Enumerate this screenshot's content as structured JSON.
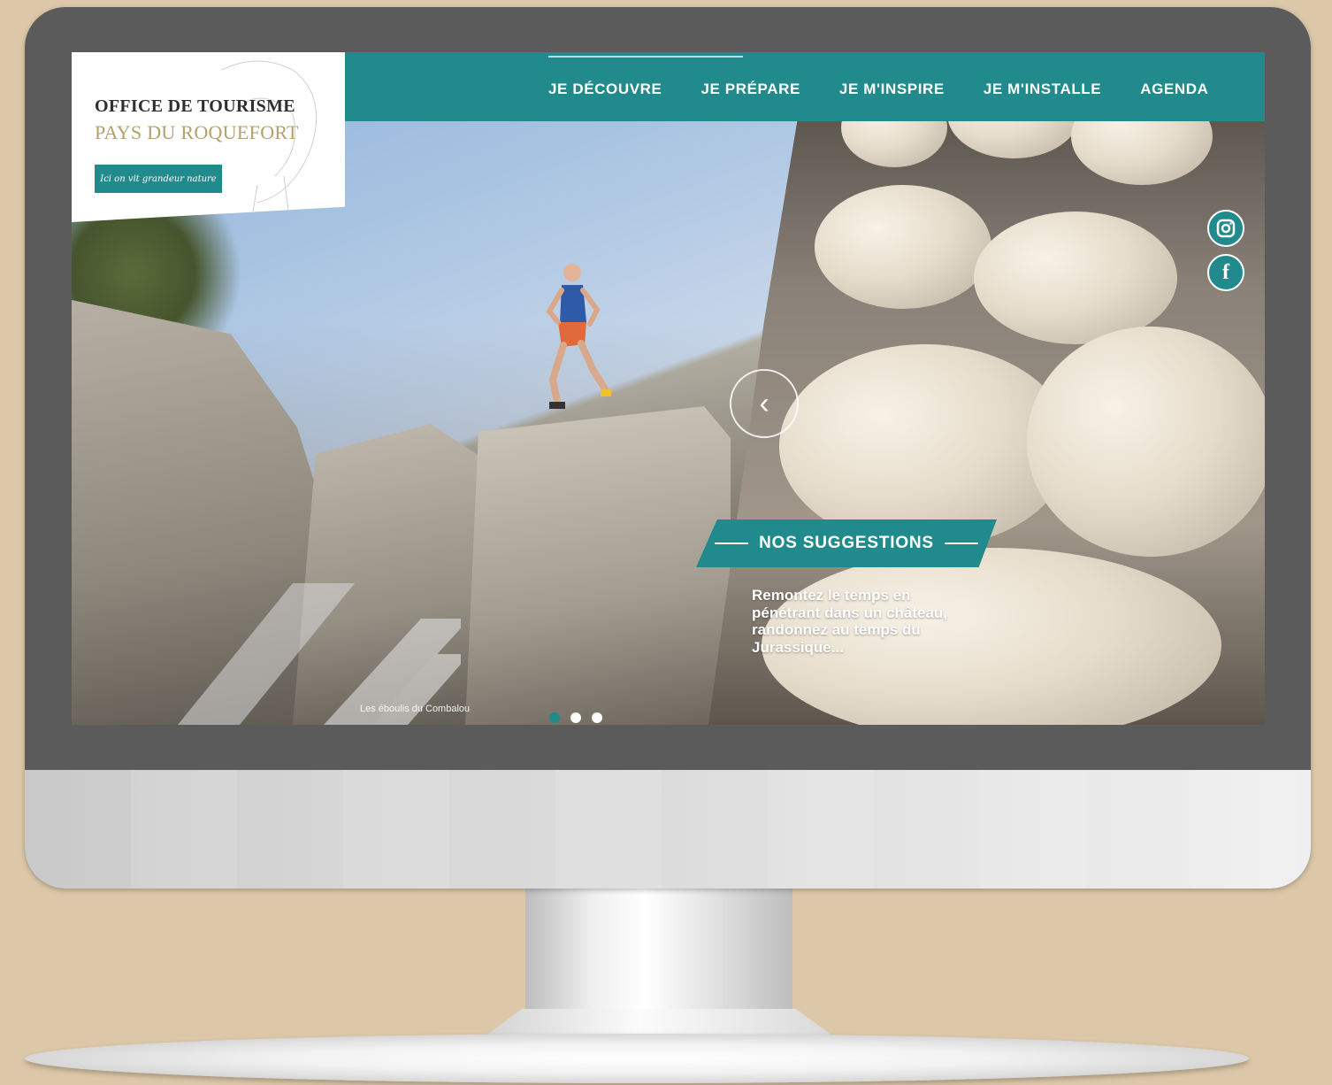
{
  "site": {
    "logo": {
      "line1": "OFFICE DE TOURISME",
      "line2": "PAYS DU ROQUEFORT",
      "tagline": "Ici on vit grandeur nature"
    },
    "nav": [
      {
        "label": "JE DÉCOUVRE"
      },
      {
        "label": "JE PRÉPARE"
      },
      {
        "label": "JE M'INSPIRE"
      },
      {
        "label": "JE M'INSTALLE"
      },
      {
        "label": "AGENDA"
      }
    ],
    "hero": {
      "caption": "Les éboulis du Combalou",
      "dots": {
        "count": 3,
        "active_index": 0
      }
    },
    "suggestions": {
      "title": "NOS SUGGESTIONS",
      "text": "Remontez le temps en pénétrant dans un château, randonnez au temps du Jurassique..."
    },
    "social": [
      {
        "name": "instagram-icon"
      },
      {
        "name": "facebook-icon",
        "glyph": "f"
      }
    ],
    "prev_arrow_glyph": "‹",
    "colors": {
      "accent": "#218a8c",
      "background": "#dcc7a8",
      "logo_gold": "#b3a06a"
    }
  }
}
